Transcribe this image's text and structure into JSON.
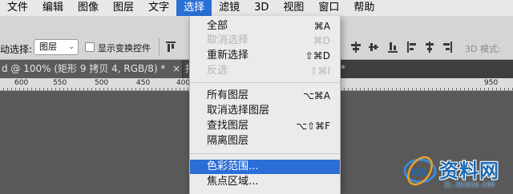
{
  "menubar": {
    "items": [
      {
        "label": "文件"
      },
      {
        "label": "编辑"
      },
      {
        "label": "图像"
      },
      {
        "label": "图层"
      },
      {
        "label": "文字"
      },
      {
        "label": "选择",
        "active": true
      },
      {
        "label": "滤镜"
      },
      {
        "label": "3D"
      },
      {
        "label": "视图"
      },
      {
        "label": "窗口"
      },
      {
        "label": "帮助"
      }
    ]
  },
  "options": {
    "auto_select_label": "动选择:",
    "auto_select_value": "图层",
    "show_transform_label": "显示变换控件",
    "mode_label": "3D 模式:"
  },
  "tabs": {
    "active_tab": "d @ 100% (矩形 9 拷贝 4, RGB/8) *",
    "close_glyph": "×",
    "second_tab": "报",
    "third_close": "*"
  },
  "ruler": {
    "labels": [
      "600",
      "550",
      "500",
      "450",
      "400",
      "",
      "",
      "",
      "",
      "",
      "",
      "",
      "950"
    ]
  },
  "select_menu": {
    "items": [
      {
        "label": "全部",
        "shortcut": "⌘A",
        "disabled": false
      },
      {
        "label": "取消选择",
        "shortcut": "⌘D",
        "disabled": true
      },
      {
        "label": "重新选择",
        "shortcut": "⇧⌘D",
        "disabled": false
      },
      {
        "label": "反选",
        "shortcut": "⇧⌘I",
        "disabled": true
      },
      {
        "label": "所有图层",
        "shortcut": "⌥⌘A",
        "disabled": false
      },
      {
        "label": "取消选择图层",
        "shortcut": "",
        "disabled": false
      },
      {
        "label": "查找图层",
        "shortcut": "⌥⇧⌘F",
        "disabled": false
      },
      {
        "label": "隔离图层",
        "shortcut": "",
        "disabled": false
      },
      {
        "label": "色彩范围...",
        "shortcut": "",
        "disabled": false,
        "highlighted": true
      },
      {
        "label": "焦点区域...",
        "shortcut": "",
        "disabled": false
      }
    ]
  },
  "watermark": {
    "title": "资料网",
    "url": "ZL.XS1616.COM"
  },
  "colors": {
    "accent": "#2c6ed8",
    "menubar_bg": "#e8e8e8",
    "canvas_bg": "#595959",
    "watermark": "#1e6ab3"
  }
}
